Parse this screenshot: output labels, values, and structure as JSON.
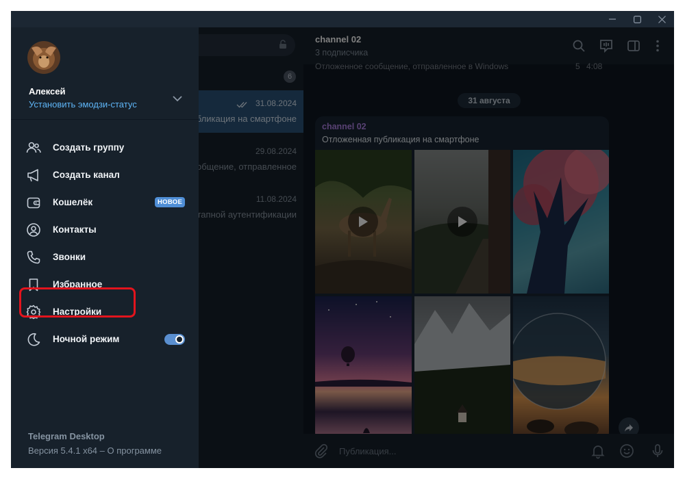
{
  "window": {
    "controls": [
      "minimize",
      "maximize",
      "close"
    ]
  },
  "chat_list": {
    "unread_badge": "6",
    "chats": [
      {
        "date": "31.08.2024",
        "preview": "публикация на смартфоне",
        "active": true,
        "read_icon": "double-check-icon"
      },
      {
        "date": "29.08.2024",
        "preview": "Отложенное сообщение, отправленное",
        "active": false
      },
      {
        "date": "11.08.2024",
        "preview": "двухэтапной аутентификации",
        "active": false
      }
    ]
  },
  "chat": {
    "title": "channel 02",
    "subtitle": "3 подписчика",
    "previous_message": "Отложенное сообщение, отправленное в Windows",
    "previous_views": "5",
    "previous_time": "4:08",
    "date_divider": "31 августа",
    "post": {
      "author": "channel 02",
      "text": "Отложенная публикация на смартфоне"
    },
    "composer_placeholder": "Публикация..."
  },
  "menu": {
    "user_name": "Алексей",
    "emoji_status": "Установить эмодзи-статус",
    "items": [
      {
        "label": "Создать группу",
        "icon": "group-icon"
      },
      {
        "label": "Создать канал",
        "icon": "megaphone-icon"
      },
      {
        "label": "Кошелёк",
        "icon": "wallet-icon",
        "badge": "НОВОЕ"
      },
      {
        "label": "Контакты",
        "icon": "contact-icon"
      },
      {
        "label": "Звонки",
        "icon": "phone-icon"
      },
      {
        "label": "Избранное",
        "icon": "bookmark-icon"
      },
      {
        "label": "Настройки",
        "icon": "gear-icon",
        "highlighted": true
      },
      {
        "label": "Ночной режим",
        "icon": "moon-icon",
        "toggle": true
      }
    ],
    "night_mode_on": true,
    "app_name": "Telegram Desktop",
    "version": "Версия 5.4.1 x64 – О программе"
  },
  "colors": {
    "accent": "#5eb5f7",
    "highlight": "#e3141d",
    "menu_bg": "#17212b",
    "chat_bg": "#0e1621"
  }
}
